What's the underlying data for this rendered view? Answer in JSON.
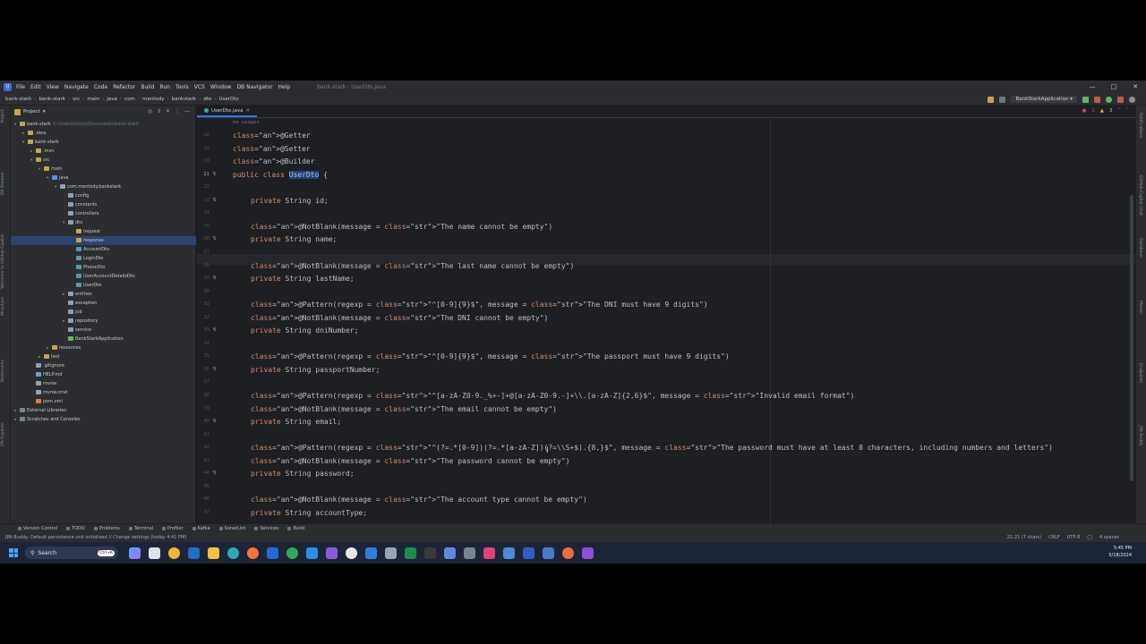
{
  "window": {
    "title": "bank-stark - UserDto.java",
    "menu": [
      "File",
      "Edit",
      "View",
      "Navigate",
      "Code",
      "Refactor",
      "Build",
      "Run",
      "Tools",
      "VCS",
      "Window",
      "DB Navigator",
      "Help"
    ]
  },
  "breadcrumb": [
    "bank-stark",
    "bank-stark",
    "src",
    "main",
    "java",
    "com",
    "mentody",
    "bankstark",
    "dto",
    "UserDto"
  ],
  "run_config": "BankStarkApplication",
  "project": {
    "header": "Project",
    "tree": [
      {
        "label": "bank-stark",
        "extra": "C:\\Users\\tonny\\Documents\\bank-stark",
        "indent": 0,
        "arrow": "▾",
        "icon": "folder"
      },
      {
        "label": ".idea",
        "indent": 1,
        "arrow": "▸",
        "icon": "folder"
      },
      {
        "label": "bank-stark",
        "indent": 1,
        "arrow": "▾",
        "icon": "folder"
      },
      {
        "label": ".mvn",
        "indent": 2,
        "arrow": "▸",
        "icon": "folder"
      },
      {
        "label": "src",
        "indent": 2,
        "arrow": "▾",
        "icon": "folder"
      },
      {
        "label": "main",
        "indent": 3,
        "arrow": "▾",
        "icon": "folder"
      },
      {
        "label": "java",
        "indent": 4,
        "arrow": "▾",
        "icon": "src"
      },
      {
        "label": "com.mentody.bankstark",
        "indent": 5,
        "arrow": "▾",
        "icon": "package"
      },
      {
        "label": "config",
        "indent": 6,
        "arrow": "",
        "icon": "package"
      },
      {
        "label": "constants",
        "indent": 6,
        "arrow": "",
        "icon": "package"
      },
      {
        "label": "controllers",
        "indent": 6,
        "arrow": "",
        "icon": "package"
      },
      {
        "label": "dto",
        "indent": 6,
        "arrow": "▾",
        "icon": "package"
      },
      {
        "label": "request",
        "indent": 7,
        "arrow": "",
        "icon": "folder"
      },
      {
        "label": "response",
        "indent": 7,
        "arrow": "",
        "icon": "folder",
        "selected": true
      },
      {
        "label": "AccountDto",
        "indent": 7,
        "arrow": "",
        "icon": "class"
      },
      {
        "label": "LoginDto",
        "indent": 7,
        "arrow": "",
        "icon": "class"
      },
      {
        "label": "PhoneDto",
        "indent": 7,
        "arrow": "",
        "icon": "class"
      },
      {
        "label": "UserAccountDetailsDto",
        "indent": 7,
        "arrow": "",
        "icon": "class"
      },
      {
        "label": "UserDto",
        "indent": 7,
        "arrow": "",
        "icon": "class"
      },
      {
        "label": "entities",
        "indent": 6,
        "arrow": "▸",
        "icon": "package"
      },
      {
        "label": "exception",
        "indent": 6,
        "arrow": "",
        "icon": "package"
      },
      {
        "label": "job",
        "indent": 6,
        "arrow": "",
        "icon": "package"
      },
      {
        "label": "repository",
        "indent": 6,
        "arrow": "▸",
        "icon": "package"
      },
      {
        "label": "service",
        "indent": 6,
        "arrow": "",
        "icon": "package"
      },
      {
        "label": "BankStarkApplication",
        "indent": 6,
        "arrow": "",
        "icon": "app"
      },
      {
        "label": "resources",
        "indent": 4,
        "arrow": "▸",
        "icon": "res"
      },
      {
        "label": "test",
        "indent": 3,
        "arrow": "▸",
        "icon": "folder"
      },
      {
        "label": ".gitignore",
        "indent": 2,
        "arrow": "",
        "icon": "file"
      },
      {
        "label": "HELP.md",
        "indent": 2,
        "arrow": "",
        "icon": "md"
      },
      {
        "label": "mvnw",
        "indent": 2,
        "arrow": "",
        "icon": "file"
      },
      {
        "label": "mvnw.cmd",
        "indent": 2,
        "arrow": "",
        "icon": "file"
      },
      {
        "label": "pom.xml",
        "indent": 2,
        "arrow": "",
        "icon": "xml"
      },
      {
        "label": "External Libraries",
        "indent": 0,
        "arrow": "▸",
        "icon": "lib"
      },
      {
        "label": "Scratches and Consoles",
        "indent": 0,
        "arrow": "▸",
        "icon": "scratch"
      }
    ]
  },
  "left_strip": [
    "Project",
    "DB Browser",
    "Welcome to GitHub Copilot",
    "Structure",
    "Bookmarks",
    "JPA Explorer"
  ],
  "right_strip": [
    "Notifications",
    "GitHub Copilot Chat",
    "Database",
    "Maven",
    "Endpoints",
    "JPA Buddy"
  ],
  "editor": {
    "tab": "UserDto.java",
    "errors": "1",
    "warnings": "3",
    "usage_hint": "no usages",
    "lines": [
      {
        "n": "18",
        "t": "@Getter"
      },
      {
        "n": "19",
        "t": "@Setter"
      },
      {
        "n": "20",
        "t": "@Builder"
      },
      {
        "n": "21",
        "t": "public class UserDto {"
      },
      {
        "n": "22",
        "t": ""
      },
      {
        "n": "23",
        "t": "private String id;"
      },
      {
        "n": "24",
        "t": ""
      },
      {
        "n": "25",
        "t": "@NotBlank(message = \"The name cannot be empty\")"
      },
      {
        "n": "26",
        "t": "private String name;"
      },
      {
        "n": "27",
        "t": ""
      },
      {
        "n": "28",
        "t": "@NotBlank(message = \"The last name cannot be empty\")"
      },
      {
        "n": "29",
        "t": "private String lastName;"
      },
      {
        "n": "30",
        "t": ""
      },
      {
        "n": "31",
        "t": "@Pattern(regexp = \"^[0-9]{9}$\", message = \"The DNI must have 9 digits\")"
      },
      {
        "n": "32",
        "t": "@NotBlank(message = \"The DNI cannot be empty\")"
      },
      {
        "n": "33",
        "t": "private String dniNumber;"
      },
      {
        "n": "34",
        "t": ""
      },
      {
        "n": "35",
        "t": "@Pattern(regexp = \"^[0-9]{9}$\", message = \"The passport must have 9 digits\")"
      },
      {
        "n": "36",
        "t": "private String passportNumber;"
      },
      {
        "n": "37",
        "t": ""
      },
      {
        "n": "38",
        "t": "@Pattern(regexp = \"^[a-zA-Z0-9._%+-]+@[a-zA-Z0-9.-]+\\\\.[a-zA-Z]{2,6}$\", message = \"Invalid email format\")"
      },
      {
        "n": "39",
        "t": "@NotBlank(message = \"The email cannot be empty\")"
      },
      {
        "n": "40",
        "t": "private String email;"
      },
      {
        "n": "41",
        "t": ""
      },
      {
        "n": "42",
        "t": "@Pattern(regexp = \"^(?=.*[0-9])(?=.*[a-zA-Z])(?=\\\\S+$).{8,}$\", message = \"The password must have at least 8 characters, including numbers and letters\")"
      },
      {
        "n": "43",
        "t": "@NotBlank(message = \"The password cannot be empty\")"
      },
      {
        "n": "44",
        "t": "private String password;"
      },
      {
        "n": "45",
        "t": ""
      },
      {
        "n": "46",
        "t": "@NotBlank(message = \"The account type cannot be empty\")"
      },
      {
        "n": "47",
        "t": "private String accountType;"
      }
    ]
  },
  "tool_windows": [
    "Version Control",
    "TODO",
    "Problems",
    "Terminal",
    "Profiler",
    "Kafka",
    "SonarLint",
    "Services",
    "Build"
  ],
  "status": {
    "message": "JPA Buddy: Default persistence unit initialized // Change settings (today 4:41 PM)",
    "position": "21:21 (7 chars)",
    "line_sep": "CRLF",
    "encoding": "UTF-8",
    "indent": "4 spaces"
  },
  "taskbar": {
    "search": "Search",
    "ctrl_badge": "Ctrl+K",
    "time": "5:45 PM",
    "date": "5/18/2024"
  }
}
